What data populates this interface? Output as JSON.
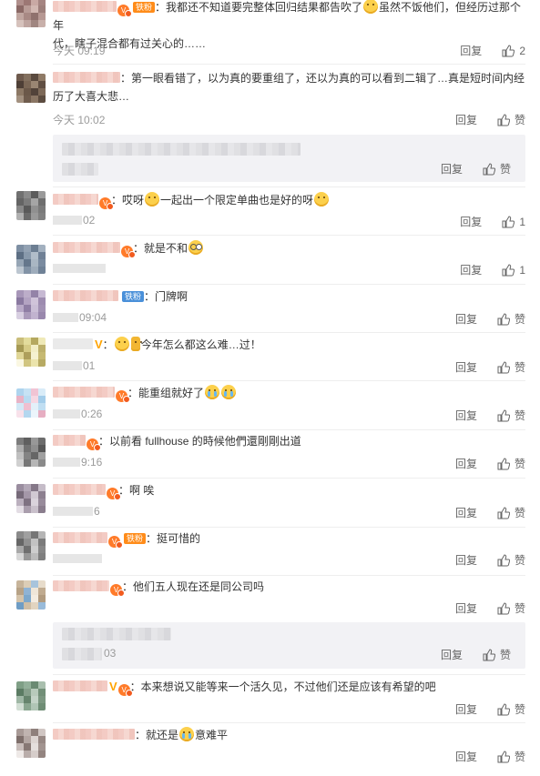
{
  "comments": [
    {
      "text": "：我都还不知道要完整体回归结果都告吹了",
      "text2": "虽然不饭他们，但经历过那个年",
      "line2": "代，瞎子混合都有过关心的……",
      "badge": "铁粉",
      "time": "今天 09:19",
      "reply": "回复",
      "like": "2"
    },
    {
      "text": "：第一眼看错了，以为真的要重组了，还以为真的可以看到二辑了…真是短时间内经",
      "line2": "历了大喜大悲…",
      "time": "今天 10:02",
      "reply": "回复",
      "like": "赞",
      "sub": {
        "reply": "回复",
        "like": "赞"
      }
    },
    {
      "text": "：哎呀",
      "text2": "一起出一个限定单曲也是好的呀",
      "time": "02",
      "reply": "回复",
      "like": "1"
    },
    {
      "text": "：就是不和",
      "time": "",
      "reply": "回复",
      "like": "1"
    },
    {
      "badge": "铁粉",
      "text": "：门牌啊",
      "time": "09:04",
      "reply": "回复",
      "like": "赞"
    },
    {
      "badge_v": "V",
      "text": "今年怎么都这么难…过！",
      "time": "01",
      "reply": "回复",
      "like": "赞"
    },
    {
      "text": "：能重组就好了",
      "time": "0:26",
      "reply": "回复",
      "like": "赞"
    },
    {
      "text": "：以前看 fullhouse 的時候他們還剛剛出道",
      "time": "9:16",
      "reply": "回复",
      "like": "赞"
    },
    {
      "text": "：啊 唉",
      "time": "6",
      "reply": "回复",
      "like": "赞"
    },
    {
      "badge": "铁粉",
      "text": "：挺可惜的",
      "time": "",
      "reply": "回复",
      "like": "赞"
    },
    {
      "text": "：他们五人现在还是同公司吗",
      "time": "",
      "reply": "回复",
      "like": "赞",
      "sub": {
        "time": "03",
        "reply": "回复",
        "like": "赞"
      }
    },
    {
      "badge_v": "V",
      "text": "：本来想说又能等来一个活久见，不过他们还是应该有希望的吧",
      "time": "",
      "reply": "回复",
      "like": "赞"
    },
    {
      "text": "：就还是",
      "text2": "意难平",
      "time": "",
      "reply": "回复",
      "like": "赞"
    }
  ],
  "colors": {
    "badge_orange": "#ff8c1a",
    "badge_blue": "#4a90d9",
    "vip": "#ff7b2a",
    "subreply_bg": "#f2f2f5"
  }
}
